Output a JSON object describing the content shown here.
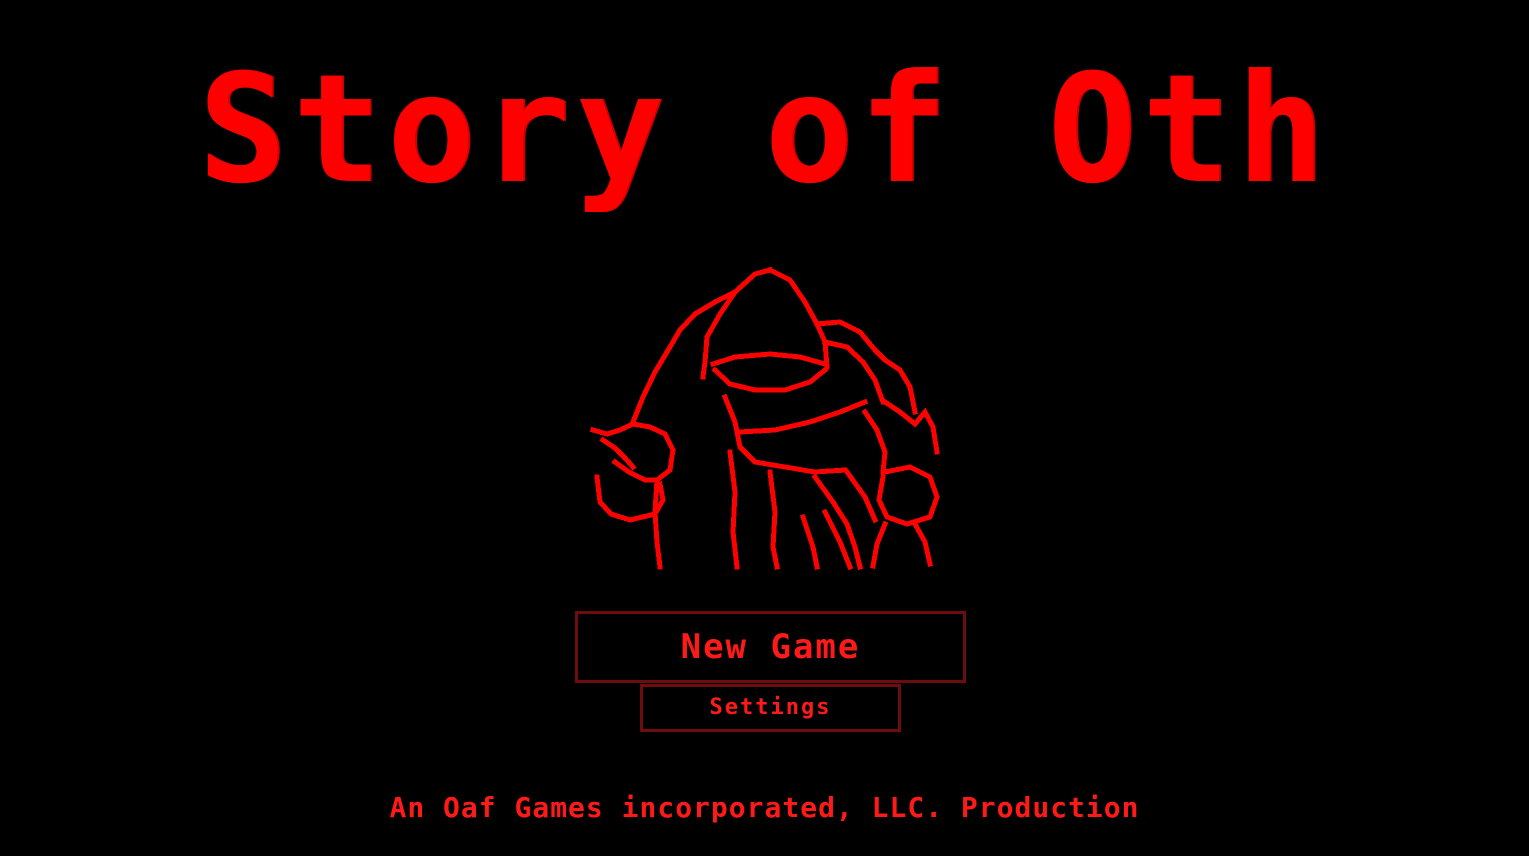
{
  "game": {
    "title": "Story of Oth",
    "credit": "An Oaf Games incorporated, LLC. Production"
  },
  "menu": {
    "new_game_label": "New Game",
    "settings_label": "Settings"
  },
  "artwork": {
    "icon": "hooded-figure-icon"
  },
  "colors": {
    "background": "#000000",
    "accent": "#ff0000",
    "button_border": "#6e0d0d"
  }
}
